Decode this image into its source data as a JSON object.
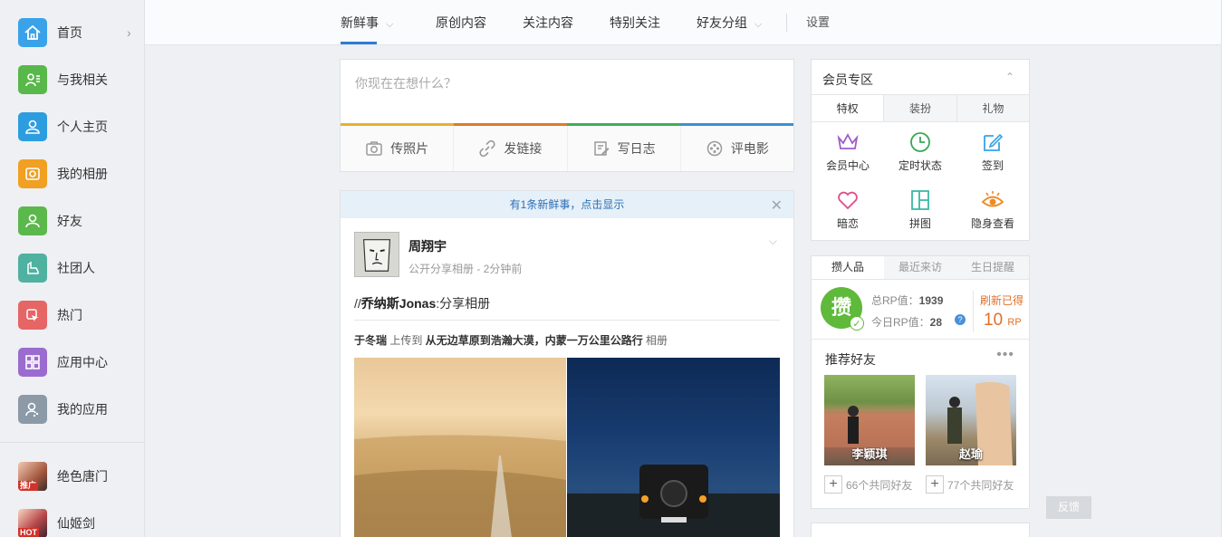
{
  "sidebar": {
    "items": [
      {
        "label": "首页",
        "icon": "home-icon",
        "color": "#3aa2e8"
      },
      {
        "label": "与我相关",
        "icon": "related-icon",
        "color": "#58b84a"
      },
      {
        "label": "个人主页",
        "icon": "profile-icon",
        "color": "#2d9de0"
      },
      {
        "label": "我的相册",
        "icon": "album-icon",
        "color": "#f0a023"
      },
      {
        "label": "好友",
        "icon": "friends-icon",
        "color": "#5bb84b"
      },
      {
        "label": "社团人",
        "icon": "club-icon",
        "color": "#4fb1a0"
      },
      {
        "label": "热门",
        "icon": "hot-icon",
        "color": "#e66565"
      },
      {
        "label": "应用中心",
        "icon": "app-center-icon",
        "color": "#9b6ccf"
      },
      {
        "label": "我的应用",
        "icon": "my-apps-icon",
        "color": "#8c99a6"
      }
    ],
    "games": [
      {
        "label": "绝色唐门",
        "tag": "推广"
      },
      {
        "label": "仙姬剑",
        "tag": "HOT"
      }
    ]
  },
  "topnav": {
    "tabs": [
      "新鲜事",
      "原创内容",
      "关注内容",
      "特别关注",
      "好友分组"
    ],
    "settings": "设置"
  },
  "composer": {
    "placeholder": "你现在在想什么？",
    "actions": [
      "传照片",
      "发链接",
      "写日志",
      "评电影"
    ],
    "bar_colors": [
      "#e8b12a",
      "#e07a2a",
      "#3fae57",
      "#3b8fd8"
    ]
  },
  "feed": {
    "notice": "有1条新鲜事，点击显示",
    "author": "周翔宇",
    "meta": "公开分享相册 - 2分钟前",
    "text_prefix": "//",
    "text_name": "乔纳斯Jonas",
    "text_suffix": ":分享相册",
    "upload_user": "于冬瑞",
    "upload_mid": " 上传到 ",
    "upload_album": "从无边草原到浩瀚大漠，内蒙一万公里公路行",
    "upload_suffix": " 相册"
  },
  "member": {
    "title": "会员专区",
    "tabs": [
      "特权",
      "装扮",
      "礼物"
    ],
    "grid": [
      {
        "label": "会员中心",
        "icon": "crown-icon",
        "color": "#a05cc8"
      },
      {
        "label": "定时状态",
        "icon": "clock-icon",
        "color": "#3aa858"
      },
      {
        "label": "签到",
        "icon": "edit-icon",
        "color": "#3aa2e8"
      },
      {
        "label": "暗恋",
        "icon": "heart-icon",
        "color": "#e24d8a"
      },
      {
        "label": "拼图",
        "icon": "puzzle-icon",
        "color": "#3bb8a5"
      },
      {
        "label": "隐身查看",
        "icon": "eye-icon",
        "color": "#f08a24"
      }
    ]
  },
  "rp": {
    "tabs": [
      "攒人品",
      "最近来访",
      "生日提醒"
    ],
    "badge": "攒",
    "total_label": "总RP值：",
    "total_value": "1939",
    "today_label": "今日RP值：",
    "today_value": "28",
    "refresh": "刷新已得",
    "gain": "10",
    "gain_unit": "RP",
    "rec_title": "推荐好友",
    "friends": [
      {
        "name": "李颖琪",
        "mutual": "66个共同好友"
      },
      {
        "name": "赵瑜",
        "mutual": "77个共同好友"
      }
    ]
  },
  "feedback": "反馈"
}
